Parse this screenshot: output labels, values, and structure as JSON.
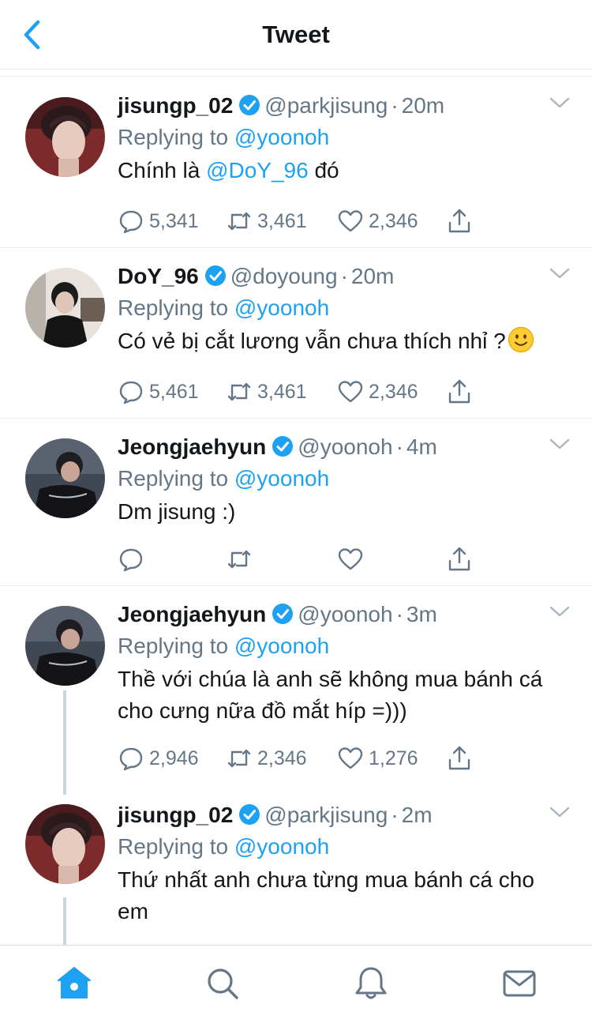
{
  "header": {
    "title": "Tweet",
    "back_icon": "chevron-left-icon"
  },
  "colors": {
    "accent": "#1da1f2",
    "text": "#14171a",
    "muted": "#657786",
    "border": "#e6ecf0",
    "thread_line": "#ccd6dd"
  },
  "tweets": [
    {
      "name": "jisungp_02",
      "handle": "@parkjisung",
      "dot": "·",
      "time": "20m",
      "replying_prefix": "Replying to ",
      "replying_to": "@yoonoh",
      "text_before": "Chính là ",
      "text_mention": "@DoY_96",
      "text_after": " đó",
      "replies": "5,341",
      "retweets": "3,461",
      "likes": "2,346"
    },
    {
      "name": "DoY_96",
      "handle": "@doyoung",
      "dot": "·",
      "time": "20m",
      "replying_prefix": "Replying to ",
      "replying_to": "@yoonoh",
      "text": "Có vẻ bị cắt lương vẫn chưa thích nhỉ ?",
      "emoji": "slightly-smiling-face-emoji",
      "replies": "5,461",
      "retweets": "3,461",
      "likes": "2,346"
    },
    {
      "name": "Jeongjaehyun",
      "handle": "@yoonoh",
      "dot": "·",
      "time": "4m",
      "replying_prefix": "Replying to ",
      "replying_to": "@yoonoh",
      "text": "Dm jisung :)"
    },
    {
      "name": "Jeongjaehyun",
      "handle": "@yoonoh",
      "dot": "·",
      "time": "3m",
      "replying_prefix": "Replying to ",
      "replying_to": "@yoonoh",
      "text": "Thề với chúa là anh sẽ không mua bánh cá cho cưng nữa đồ mắt híp =)))",
      "replies": "2,946",
      "retweets": "2,346",
      "likes": "1,276"
    },
    {
      "name": "jisungp_02",
      "handle": "@parkjisung",
      "dot": "·",
      "time": "2m",
      "replying_prefix": "Replying to ",
      "replying_to": "@yoonoh",
      "text": "Thứ nhất anh chưa từng mua bánh cá cho em"
    }
  ],
  "tabbar": {
    "items": [
      "home-icon",
      "search-icon",
      "notifications-bell-icon",
      "messages-envelope-icon"
    ],
    "active": "home-icon"
  }
}
